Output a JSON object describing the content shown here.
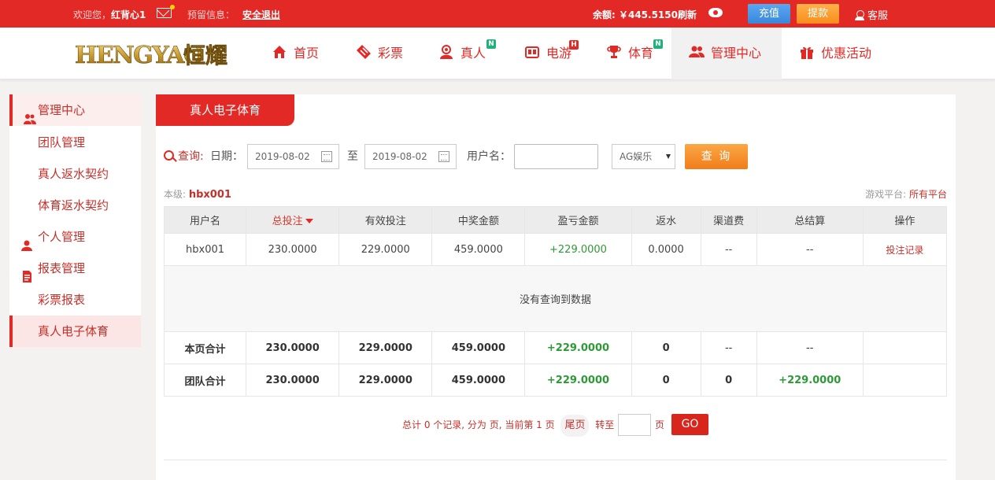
{
  "topbar": {
    "welcome_prefix": "欢迎您，",
    "username": "红背心1",
    "reserve_label": "预留信息：",
    "logout": "安全退出",
    "balance": "余额: ￥445.5150",
    "refresh": "刷新",
    "recharge": "充值",
    "withdraw": "提款",
    "service": "客服"
  },
  "logo": {
    "text": "HENGYAO恒耀"
  },
  "nav": [
    {
      "label": "首页",
      "icon": "home-icon"
    },
    {
      "label": "彩票",
      "icon": "lottery-ticket-icon"
    },
    {
      "label": "真人",
      "icon": "live-dealer-icon",
      "badge": "N"
    },
    {
      "label": "电游",
      "icon": "arcade-game-icon",
      "badge": "H"
    },
    {
      "label": "体育",
      "icon": "trophy-icon",
      "badge": "N"
    },
    {
      "label": "管理中心",
      "icon": "users-icon",
      "active": true
    },
    {
      "label": "优惠活动",
      "icon": "gift-icon"
    }
  ],
  "sidebar": [
    {
      "label": "管理中心",
      "type": "group",
      "icon": "users-icon"
    },
    {
      "label": "团队管理",
      "type": "sub"
    },
    {
      "label": "真人返水契约",
      "type": "sub"
    },
    {
      "label": "体育返水契约",
      "type": "sub"
    },
    {
      "label": "个人管理",
      "type": "group",
      "icon": "user-icon"
    },
    {
      "label": "报表管理",
      "type": "group",
      "icon": "report-icon"
    },
    {
      "label": "彩票报表",
      "type": "sub"
    },
    {
      "label": "真人电子体育",
      "type": "sub",
      "active": true
    }
  ],
  "panel": {
    "title": "真人电子体育"
  },
  "query": {
    "label": "查询:",
    "date_label": "日期：",
    "date_from": "2019-08-02",
    "to": "至",
    "date_to": "2019-08-02",
    "user_label": "用户名：",
    "user_value": "",
    "platform_select": "AG娱乐",
    "submit": "查 询"
  },
  "info": {
    "level_label": "本级: ",
    "level_value": "hbx001",
    "platform_label": "游戏平台: ",
    "platform_value": "所有平台"
  },
  "table": {
    "headers": [
      "用户名",
      "总投注",
      "有效投注",
      "中奖金额",
      "盈亏金额",
      "返水",
      "渠道费",
      "总结算",
      "操作"
    ],
    "row": [
      "hbx001",
      "230.0000",
      "229.0000",
      "459.0000",
      "+229.0000",
      "0.0000",
      "--",
      "--",
      "投注记录"
    ],
    "empty": "没有查询到数据",
    "page_sum": [
      "本页合计",
      "230.0000",
      "229.0000",
      "459.0000",
      "+229.0000",
      "0",
      "--",
      "--",
      ""
    ],
    "team_sum": [
      "团队合计",
      "230.0000",
      "229.0000",
      "459.0000",
      "+229.0000",
      "0",
      "0",
      "+229.0000",
      ""
    ]
  },
  "pager": {
    "summary": "总计 0 个记录, 分为 页, 当前第 1 页",
    "last": "尾页",
    "goto": "转至",
    "page": "页",
    "go": "GO"
  },
  "colors": {
    "brand_red": "#e32926",
    "positive_green": "#2d9a36",
    "query_orange": "#f07d1a",
    "recharge_blue": "#3987dc"
  }
}
